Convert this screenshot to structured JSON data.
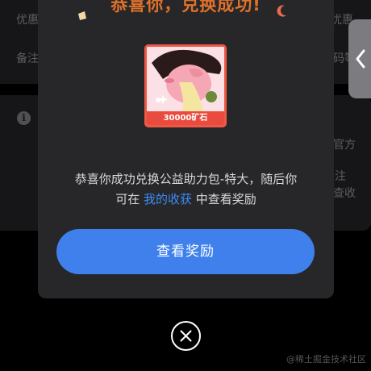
{
  "background": {
    "row1_left": "优惠",
    "row1_right": "优惠",
    "row2_left": "备注",
    "row2_right": "码等",
    "info_glyph": "i",
    "side_right_1": "官方",
    "side_right_2": "注",
    "side_right_3": "查收"
  },
  "dialog": {
    "title": "恭喜你，兑换成功!",
    "prize_label": "30000矿石",
    "message_line1": "恭喜你成功兑换公益助力包-特大，随后你",
    "message_prefix": "可在 ",
    "message_link": "我的收获",
    "message_suffix": " 中查看奖励",
    "cta_label": "查看奖励"
  },
  "watermark": "@稀土掘金技术社区",
  "icons": {
    "side_tab": "chevron-left-icon",
    "close": "close-icon",
    "info": "info-icon"
  },
  "colors": {
    "title": "#e0712b",
    "link": "#3b8cf4",
    "cta": "#3f80ec",
    "prize_border": "#ef5846"
  }
}
